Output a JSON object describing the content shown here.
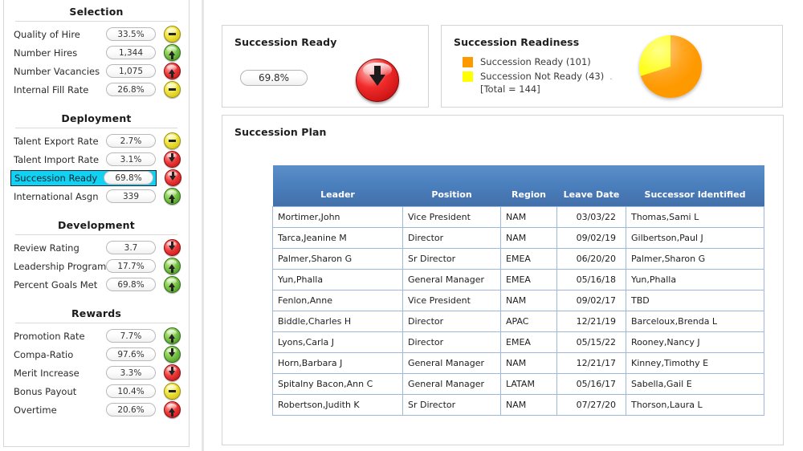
{
  "sidebar": {
    "sections": [
      {
        "title": "Selection",
        "metrics": [
          {
            "label": "Quality of Hire",
            "value": "33.5%",
            "indicator": "flat-yellow-icon"
          },
          {
            "label": "Number Hires",
            "value": "1,344",
            "indicator": "up-green-icon"
          },
          {
            "label": "Number Vacancies",
            "value": "1,075",
            "indicator": "up-red-icon"
          },
          {
            "label": "Internal Fill Rate",
            "value": "26.8%",
            "indicator": "flat-yellow-icon"
          }
        ]
      },
      {
        "title": "Deployment",
        "metrics": [
          {
            "label": "Talent Export Rate",
            "value": "2.7%",
            "indicator": "flat-yellow-icon"
          },
          {
            "label": "Talent Import Rate",
            "value": "3.1%",
            "indicator": "down-red-icon"
          },
          {
            "label": "Succession Ready",
            "value": "69.8%",
            "indicator": "down-red-icon",
            "selected": true
          },
          {
            "label": "International Asgn",
            "value": "339",
            "indicator": "up-green-icon"
          }
        ]
      },
      {
        "title": "Development",
        "metrics": [
          {
            "label": "Review Rating",
            "value": "3.7",
            "indicator": "down-red-icon"
          },
          {
            "label": "Leadership Program",
            "value": "17.7%",
            "indicator": "up-green-icon"
          },
          {
            "label": "Percent Goals Met",
            "value": "69.8%",
            "indicator": "up-green-icon"
          }
        ]
      },
      {
        "title": "Rewards",
        "metrics": [
          {
            "label": "Promotion Rate",
            "value": "7.7%",
            "indicator": "up-green-icon"
          },
          {
            "label": "Compa-Ratio",
            "value": "97.6%",
            "indicator": "down-green-icon"
          },
          {
            "label": "Merit Increase",
            "value": "3.3%",
            "indicator": "down-red-icon"
          },
          {
            "label": "Bonus Payout",
            "value": "10.4%",
            "indicator": "flat-yellow-icon"
          },
          {
            "label": "Overtime",
            "value": "20.6%",
            "indicator": "up-red-icon"
          }
        ]
      }
    ]
  },
  "ready_panel": {
    "title": "Succession Ready",
    "value": "69.8%",
    "indicator": "down-red-orb-icon"
  },
  "readiness_panel": {
    "title": "Succession Readiness",
    "legend": [
      {
        "label": "Succession Ready (101)",
        "color": "#FF9900"
      },
      {
        "label": "Succession Not Ready (43)",
        "color": "#FFFF00"
      }
    ],
    "total_label": "[Total = 144]",
    "trailing_dot": "."
  },
  "chart_data": {
    "type": "pie",
    "title": "Succession Readiness",
    "categories": [
      "Succession Ready",
      "Succession Not Ready"
    ],
    "values": [
      101,
      43
    ],
    "total": 144,
    "colors": [
      "#FF9900",
      "#FFFF00"
    ],
    "legend_position": "left",
    "grid": false
  },
  "plan_panel": {
    "title": "Succession Plan",
    "columns": [
      "Leader",
      "Position",
      "Region",
      "Leave Date",
      "Successor Identified"
    ],
    "rows": [
      {
        "leader": "Mortimer,John",
        "position": "Vice President",
        "region": "NAM",
        "leave_date": "03/03/22",
        "successor": "Thomas,Sami L"
      },
      {
        "leader": "Tarca,Jeanine M",
        "position": "Director",
        "region": "NAM",
        "leave_date": "09/02/19",
        "successor": "Gilbertson,Paul J"
      },
      {
        "leader": "Palmer,Sharon G",
        "position": "Sr Director",
        "region": "EMEA",
        "leave_date": "06/20/20",
        "successor": "Palmer,Sharon G"
      },
      {
        "leader": "Yun,Phalla",
        "position": "General Manager",
        "region": "EMEA",
        "leave_date": "05/16/18",
        "successor": "Yun,Phalla"
      },
      {
        "leader": "Fenlon,Anne",
        "position": "Vice President",
        "region": "NAM",
        "leave_date": "09/02/17",
        "successor": "TBD"
      },
      {
        "leader": "Biddle,Charles H",
        "position": "Director",
        "region": "APAC",
        "leave_date": "12/21/19",
        "successor": "Barceloux,Brenda L"
      },
      {
        "leader": "Lyons,Carla J",
        "position": "Director",
        "region": "EMEA",
        "leave_date": "05/15/22",
        "successor": "Rooney,Nancy J"
      },
      {
        "leader": "Horn,Barbara J",
        "position": "General Manager",
        "region": "NAM",
        "leave_date": "12/21/17",
        "successor": "Kinney,Timothy E"
      },
      {
        "leader": "Spitalny Bacon,Ann C",
        "position": "General Manager",
        "region": "LATAM",
        "leave_date": "05/16/17",
        "successor": "Sabella,Gail E"
      },
      {
        "leader": "Robertson,Judith K",
        "position": "Sr Director",
        "region": "NAM",
        "leave_date": "07/27/20",
        "successor": "Thorson,Laura L"
      }
    ]
  }
}
